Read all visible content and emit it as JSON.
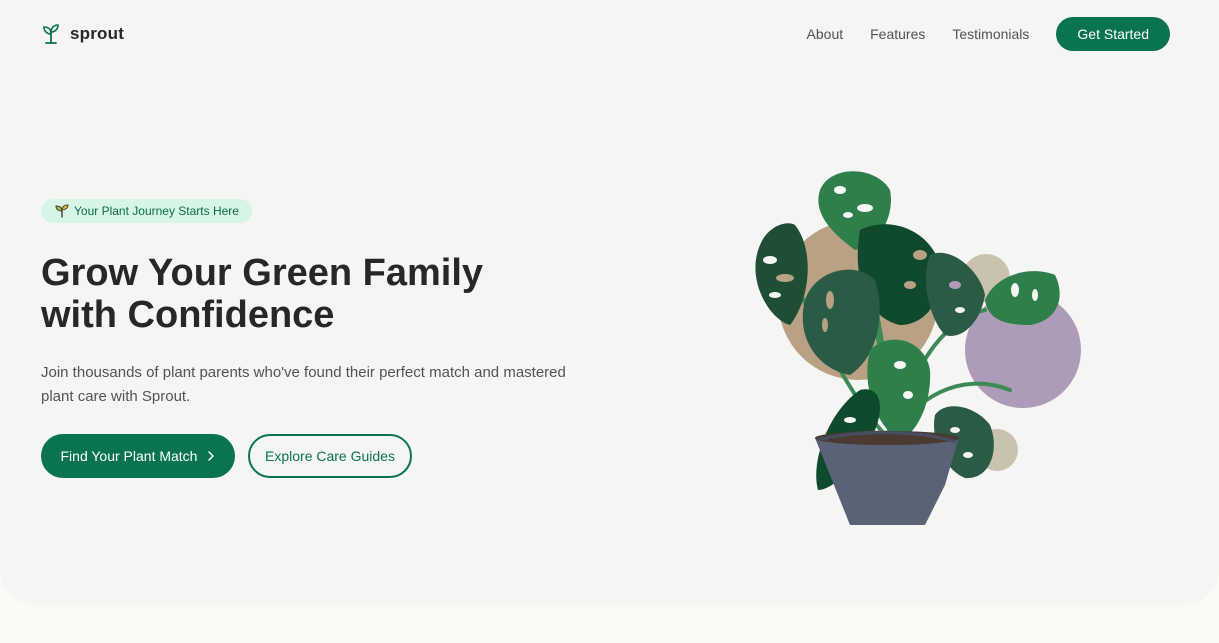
{
  "brand": {
    "name": "sprout",
    "icon": "sprout-icon",
    "color": "#0a7352"
  },
  "nav": {
    "links": [
      "About",
      "Features",
      "Testimonials"
    ],
    "cta": "Get Started"
  },
  "hero": {
    "badge": {
      "icon": "seedling-icon",
      "text": "Your Plant Journey Starts Here"
    },
    "title_line1": "Grow Your Green Family",
    "title_line2": "with Confidence",
    "subtitle": "Join thousands of plant parents who've found their perfect match and mastered plant care with Sprout.",
    "primary_button": {
      "label": "Find Your Plant Match",
      "icon": "chevron-right-icon"
    },
    "secondary_button": {
      "label": "Explore Care Guides"
    },
    "illustration": "monstera-plant-illustration"
  },
  "colors": {
    "accent": "#0a7352",
    "badge_bg": "#d7f5e6",
    "hero_bg": "#f5f5f3",
    "page_bg": "#fafaf7"
  }
}
